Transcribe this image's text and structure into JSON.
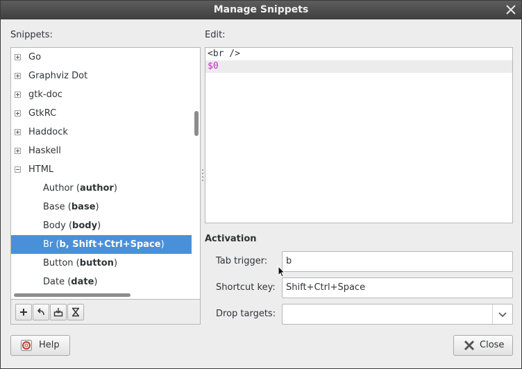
{
  "window": {
    "title": "Manage Snippets"
  },
  "snippets": {
    "label": "Snippets:",
    "items": [
      {
        "name": "Go",
        "expander": "plus",
        "indent": 0
      },
      {
        "name": "Graphviz Dot",
        "expander": "plus",
        "indent": 0
      },
      {
        "name": "gtk-doc",
        "expander": "plus",
        "indent": 0
      },
      {
        "name": "GtkRC",
        "expander": "plus",
        "indent": 0
      },
      {
        "name": "Haddock",
        "expander": "plus",
        "indent": 0
      },
      {
        "name": "Haskell",
        "expander": "plus",
        "indent": 0
      },
      {
        "name": "HTML",
        "expander": "minus",
        "indent": 0
      },
      {
        "name": "Author",
        "trigger": "author",
        "indent": 1
      },
      {
        "name": "Base",
        "trigger": "base",
        "indent": 1
      },
      {
        "name": "Body",
        "trigger": "body",
        "indent": 1
      },
      {
        "name": "Br",
        "trigger": "b, Shift+Ctrl+Space",
        "indent": 1,
        "selected": true
      },
      {
        "name": "Button",
        "trigger": "button",
        "indent": 1
      },
      {
        "name": "Date",
        "trigger": "date",
        "indent": 1
      }
    ],
    "toolbar": [
      "add-icon",
      "revert-icon",
      "import-icon",
      "export-icon"
    ]
  },
  "edit": {
    "label": "Edit:",
    "lines": [
      "<br />",
      "$0"
    ]
  },
  "activation": {
    "heading": "Activation",
    "tab_trigger_label": "Tab trigger:",
    "tab_trigger_value": "b",
    "shortcut_label": "Shortcut key:",
    "shortcut_value": "Shift+Ctrl+Space",
    "drop_targets_label": "Drop targets:",
    "drop_targets_value": ""
  },
  "buttons": {
    "help": "Help",
    "close": "Close"
  },
  "colors": {
    "selection": "#4a90d9",
    "placeholder": "#d020d0"
  }
}
